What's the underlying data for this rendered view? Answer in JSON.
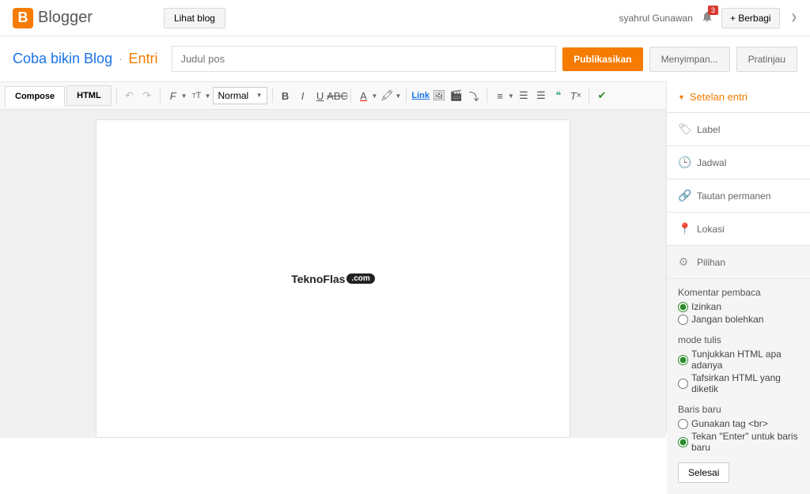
{
  "header": {
    "brand": "Blogger",
    "view_blog": "Lihat blog",
    "user": "syahrul Gunawan",
    "notif_count": "3",
    "share": "Berbagi"
  },
  "title_row": {
    "blog_name": "Coba bikin Blog",
    "separator": "·",
    "section": "Entri",
    "post_title_placeholder": "Judul pos",
    "publish": "Publikasikan",
    "saving": "Menyimpan...",
    "preview": "Pratinjau"
  },
  "toolbar": {
    "compose": "Compose",
    "html": "HTML",
    "format": "Normal",
    "link": "Link"
  },
  "canvas": {
    "placeholder_brand": "TeknoFlas",
    "placeholder_tld": ".com"
  },
  "sidebar": {
    "settings_title": "Setelan entri",
    "label": "Label",
    "jadwal": "Jadwal",
    "permalink": "Tautan permanen",
    "lokasi": "Lokasi",
    "pilihan": "Pilihan"
  },
  "options": {
    "komentar_label": "Komentar pembaca",
    "izinkan": "Izinkan",
    "jangan": "Jangan bolehkan",
    "mode_label": "mode tulis",
    "tunjukkan": "Tunjukkan HTML apa adanya",
    "tafsirkan": "Tafsirkan HTML yang diketik",
    "baris_label": "Baris baru",
    "gunakan_br": "Gunakan tag <br>",
    "tekan_enter": "Tekan \"Enter\" untuk baris baru",
    "selesai": "Selesai"
  }
}
